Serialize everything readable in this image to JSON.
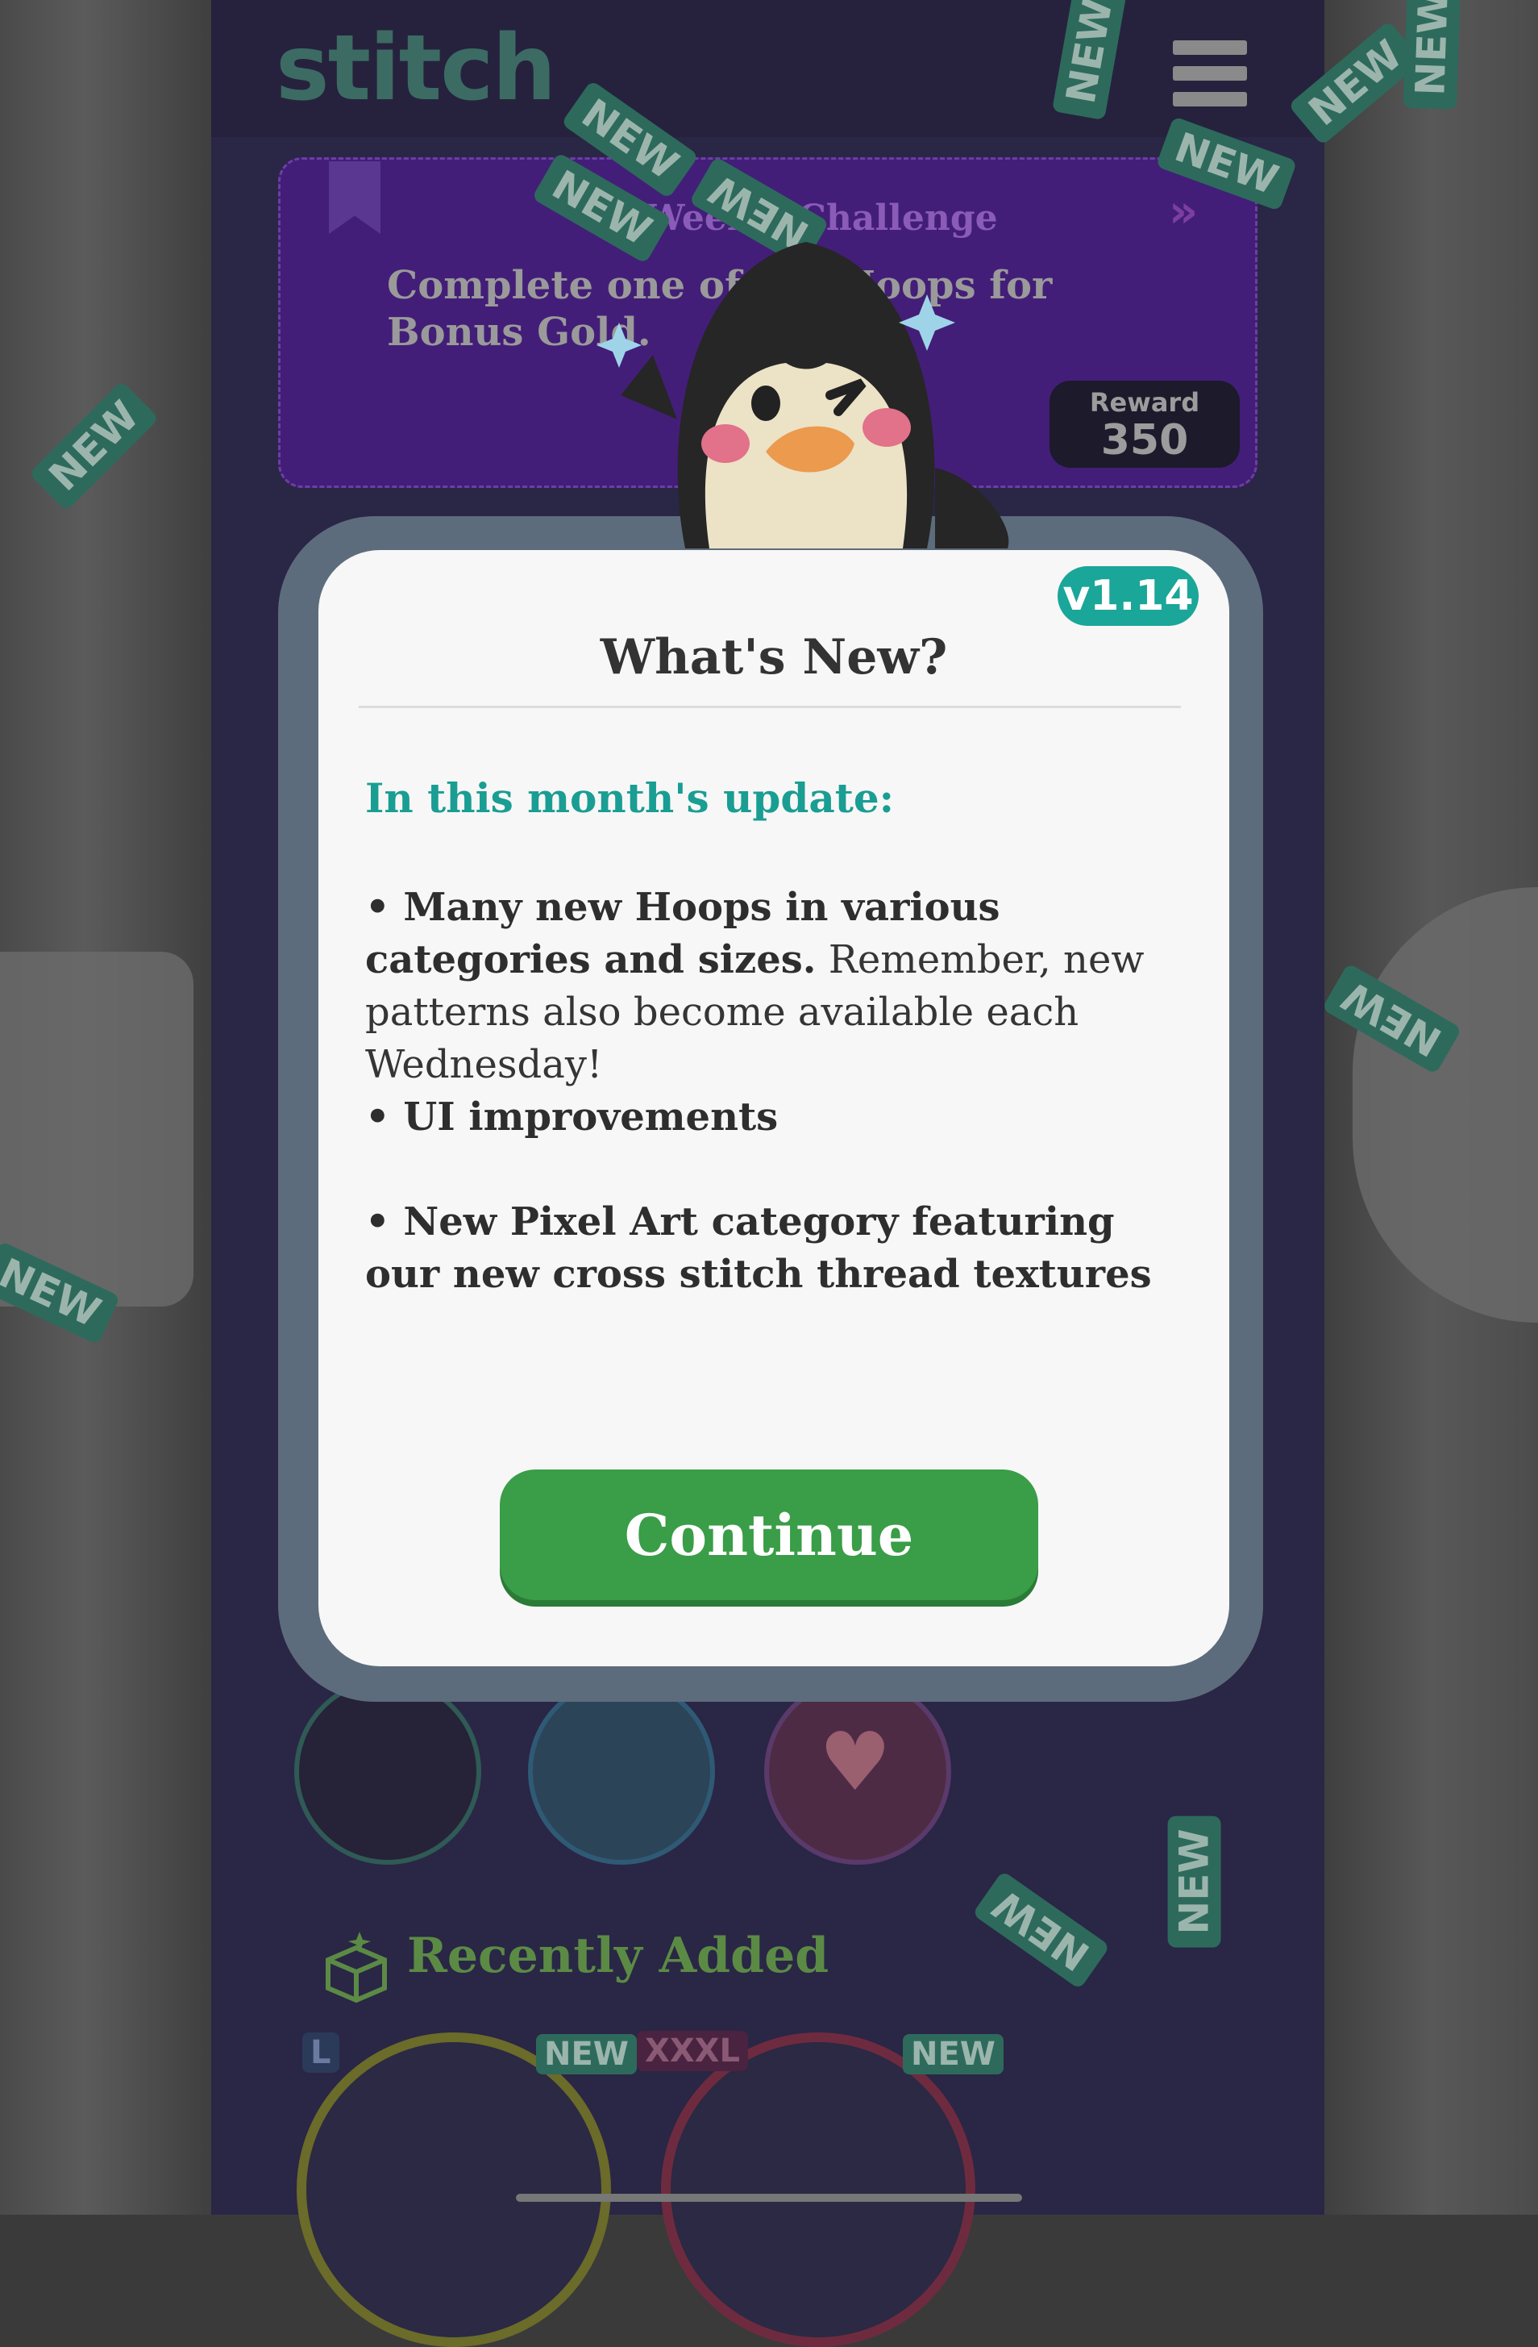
{
  "app": {
    "logo": "stitch"
  },
  "challenge": {
    "title": "Weekly Challenge",
    "text": "Complete one of the Hoops for Bonus Gold.",
    "reward_label": "Reward",
    "reward_value": "350"
  },
  "new_tag_label": "NEW",
  "modal": {
    "version": "v1.14",
    "title": "What's New?",
    "subtitle": "In this month's update:",
    "items": [
      {
        "bold": "• Many new Hoops in various categories and sizes.",
        "rest": " Remember, new patterns also become available each Wednesday!"
      },
      {
        "bold": "• UI improvements",
        "rest": ""
      },
      {
        "bold": "• New Pixel Art category featuring our new cross stitch thread textures",
        "rest": ""
      }
    ],
    "continue_label": "Continue"
  },
  "recently_added": {
    "title": "Recently Added",
    "badges": [
      "L",
      "NEW",
      "XXXL",
      "NEW"
    ]
  },
  "colors": {
    "teal": "#1aa699",
    "green": "#3a9d47",
    "purple": "#431e78"
  }
}
